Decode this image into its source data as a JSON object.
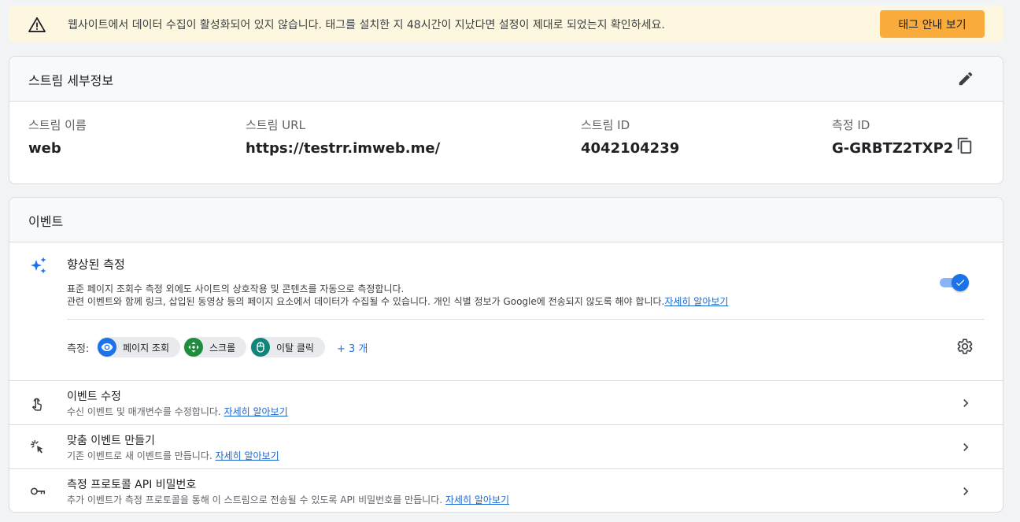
{
  "banner": {
    "icon": "warning-icon",
    "message": "웹사이트에서 데이터 수집이 활성화되어 있지 않습니다. 태그를 설치한 지 48시간이 지났다면 설정이 제대로 되었는지 확인하세요.",
    "button_label": "태그 안내 보기",
    "button_color": "#f9ab3b"
  },
  "stream_details": {
    "title": "스트림 세부정보",
    "fields": [
      {
        "label": "스트림 이름",
        "value": "web"
      },
      {
        "label": "스트림 URL",
        "value": "https://testrr.imweb.me/"
      },
      {
        "label": "스트림 ID",
        "value": "4042104239"
      },
      {
        "label": "측정 ID",
        "value": "G-GRBTZ2TXP2"
      }
    ]
  },
  "events": {
    "title": "이벤트",
    "enhanced": {
      "title": "향상된 측정",
      "desc_line1": "표준 페이지 조회수 측정 외에도 사이트의 상호작용 및 콘텐츠를 자동으로 측정합니다.",
      "desc_line2": "관련 이벤트와 함께 링크, 삽입된 동영상 등의 페이지 요소에서 데이터가 수집될 수 있습니다. 개인 식별 정보가 Google에 전송되지 않도록 해야 합니다.",
      "learn_more": "자세히 알아보기",
      "toggle_on": true,
      "measure_label": "측정:",
      "chips": [
        {
          "label": "페이지 조회",
          "icon": "eye-icon",
          "color": "#1a73e8"
        },
        {
          "label": "스크롤",
          "icon": "scroll-icon",
          "color": "#1e8e3e"
        },
        {
          "label": "이탈 클릭",
          "icon": "mouse-icon",
          "color": "#12857a"
        }
      ],
      "more": "+ 3 개"
    },
    "rows": [
      {
        "title": "이벤트 수정",
        "subtitle": "수신 이벤트 및 매개변수를 수정합니다.",
        "link": "자세히 알아보기",
        "icon": "touch-icon"
      },
      {
        "title": "맞춤 이벤트 만들기",
        "subtitle": "기존 이벤트로 새 이벤트를 만듭니다.",
        "link": "자세히 알아보기",
        "icon": "click-icon"
      },
      {
        "title": "측정 프로토콜 API 비밀번호",
        "subtitle": "추가 이벤트가 측정 프로토콜을 통해 이 스트림으로 전송될 수 있도록 API 비밀번호를 만듭니다.",
        "link": "자세히 알아보기",
        "icon": "key-icon"
      }
    ]
  }
}
